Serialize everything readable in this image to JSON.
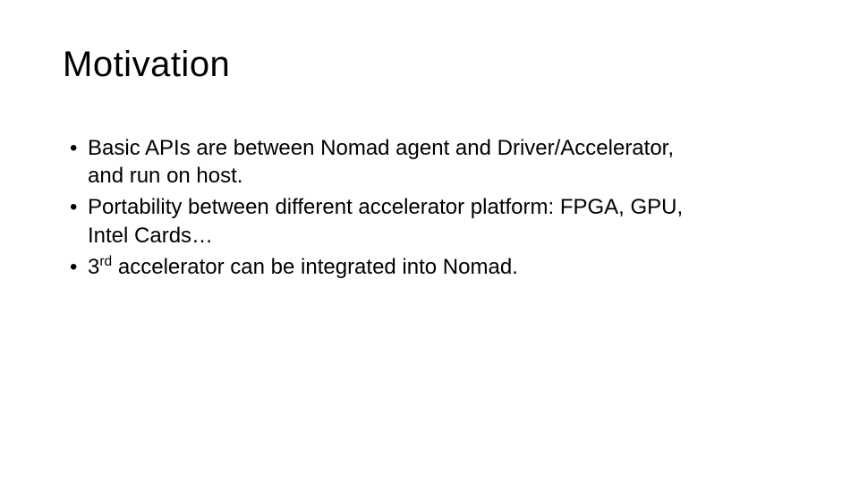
{
  "slide": {
    "title": "Motivation",
    "bullets": [
      {
        "line1": "Basic APIs are between Nomad agent and Driver/Accelerator,",
        "line2": "and run on host."
      },
      {
        "line1": "Portability between different accelerator platform: FPGA, GPU,",
        "line2": "Intel Cards…"
      },
      {
        "prefix": "3",
        "sup": "rd",
        "suffix": " accelerator can be integrated into Nomad."
      }
    ]
  }
}
